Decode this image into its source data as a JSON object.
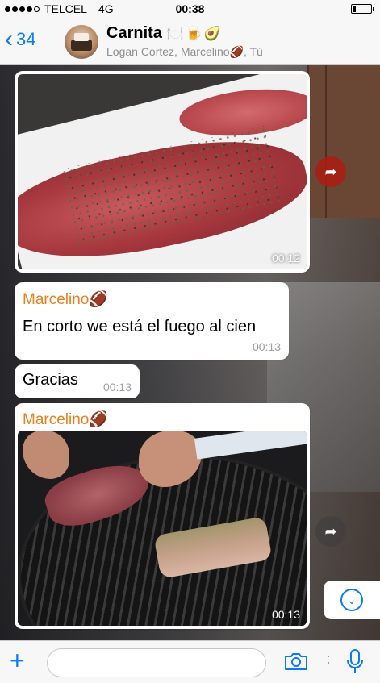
{
  "status_bar": {
    "carrier": "TELCEL",
    "network": "4G",
    "time": "00:38",
    "signal_bars_filled": 4,
    "signal_bars_total": 5,
    "battery_level": 0.2
  },
  "header": {
    "back_count": "34",
    "title": "Carnita",
    "title_emojis": "🍽️🍺🥑",
    "subtitle": "Logan Cortez, Marcelino🏈, Tú"
  },
  "messages": [
    {
      "type": "media",
      "direction": "incoming",
      "time": "00:12",
      "content": "photo-meat-tray"
    },
    {
      "type": "text",
      "direction": "incoming",
      "sender": "Marcelino🏈",
      "text": "En corto we está el fuego al cien",
      "time": "00:13"
    },
    {
      "type": "text",
      "direction": "incoming",
      "text": "Gracias",
      "time": "00:13"
    },
    {
      "type": "media",
      "direction": "incoming",
      "sender": "Marcelino🏈",
      "time": "00:13",
      "content": "photo-grill"
    }
  ],
  "icons": {
    "back": "chevron-left-icon",
    "forward": "forward-share-icon",
    "scroll_down": "chevron-down-circle-icon",
    "attach": "plus-icon",
    "camera": "camera-icon",
    "mic": "microphone-icon"
  },
  "colors": {
    "accent": "#0a7aff",
    "sender_name": "#e6821e",
    "bubble": "#ffffff",
    "timestamp": "#a0a0a0"
  },
  "input": {
    "placeholder": "",
    "value": ""
  }
}
